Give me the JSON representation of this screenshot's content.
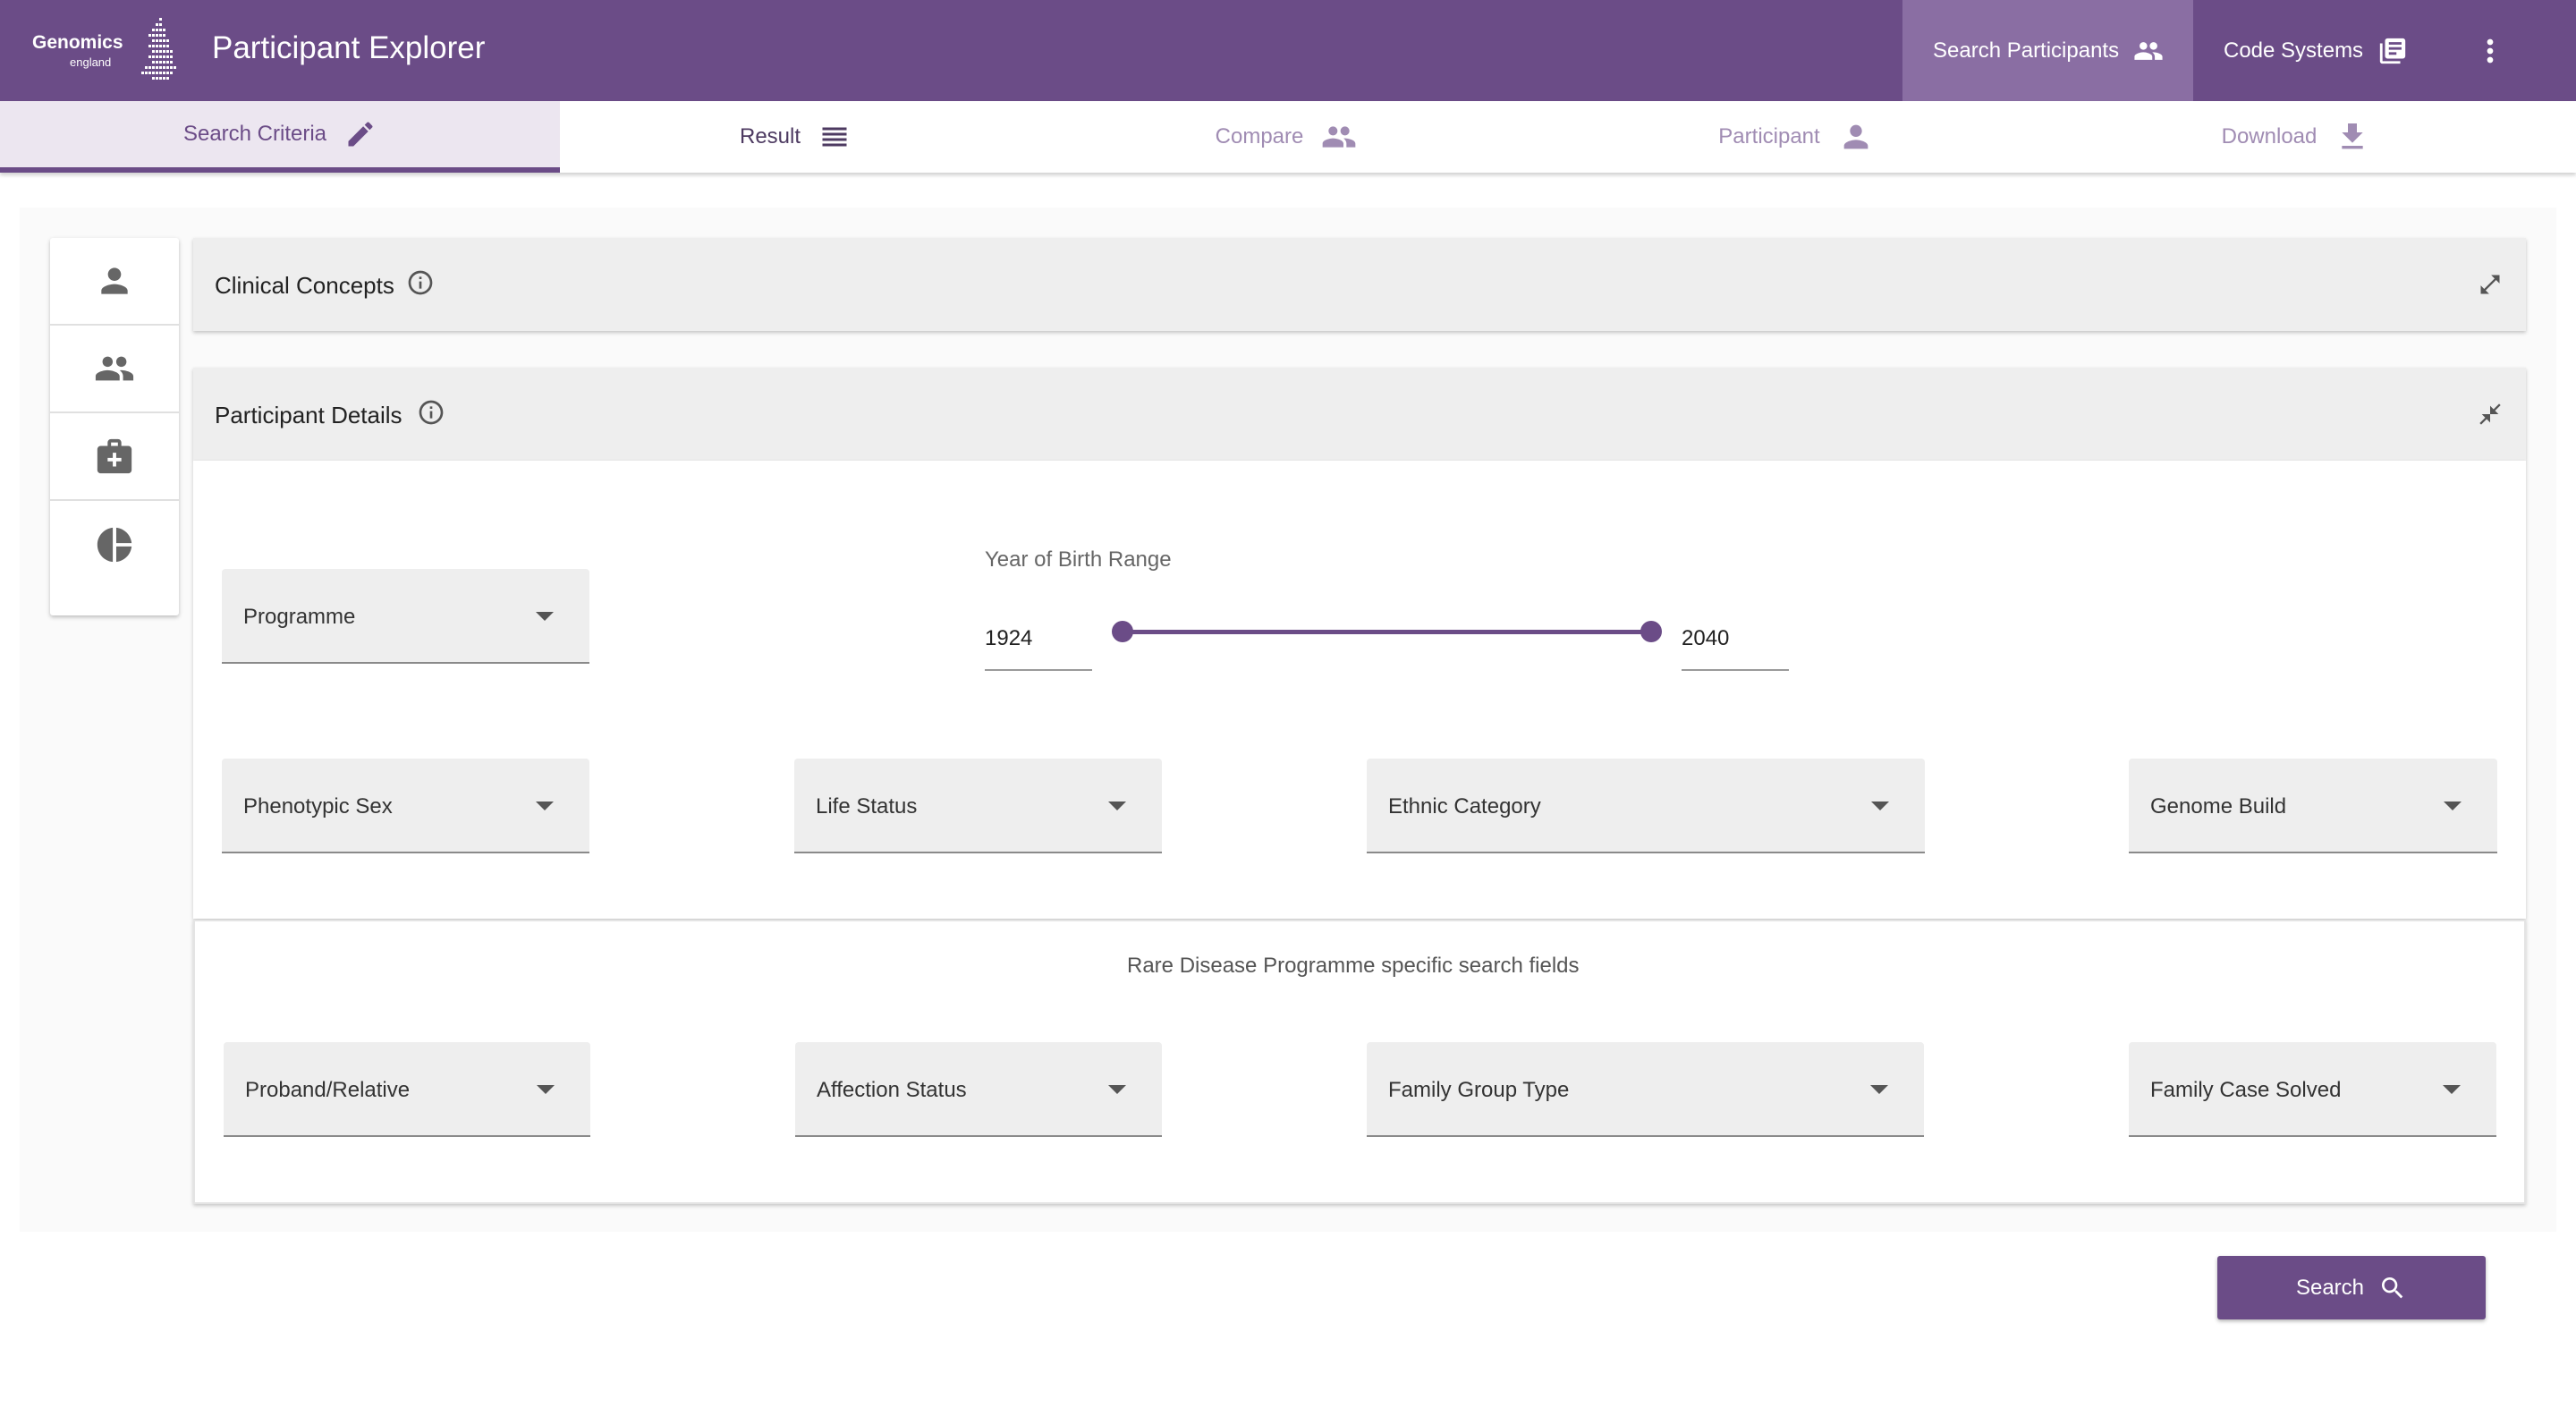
{
  "header": {
    "logo_line1": "Genomics",
    "logo_line2": "england",
    "app_title": "Participant Explorer",
    "search_participants_label": "Search Participants",
    "code_systems_label": "Code Systems",
    "brand_color": "#6b4c87"
  },
  "tabs": [
    {
      "label": "Search Criteria",
      "icon": "pencil-icon",
      "state": "active"
    },
    {
      "label": "Result",
      "icon": "list-icon",
      "state": "enabled"
    },
    {
      "label": "Compare",
      "icon": "people-icon",
      "state": "disabled"
    },
    {
      "label": "Participant",
      "icon": "person-icon",
      "state": "disabled"
    },
    {
      "label": "Download",
      "icon": "download-icon",
      "state": "disabled"
    }
  ],
  "sidenav": [
    "person-icon",
    "people-icon",
    "medical-bag-icon",
    "pie-chart-icon"
  ],
  "clinical_concepts": {
    "title": "Clinical Concepts",
    "expanded": false
  },
  "participant_details": {
    "title": "Participant Details",
    "expanded": true,
    "programme_label": "Programme",
    "year_of_birth": {
      "label": "Year of Birth Range",
      "min": "1924",
      "max": "2040"
    },
    "phenotypic_sex_label": "Phenotypic Sex",
    "life_status_label": "Life Status",
    "ethnic_category_label": "Ethnic Category",
    "genome_build_label": "Genome Build"
  },
  "rare_disease": {
    "title": "Rare Disease Programme specific search fields",
    "proband_relative_label": "Proband/Relative",
    "affection_status_label": "Affection Status",
    "family_group_type_label": "Family Group Type",
    "family_case_solved_label": "Family Case Solved"
  },
  "search_button_label": "Search"
}
